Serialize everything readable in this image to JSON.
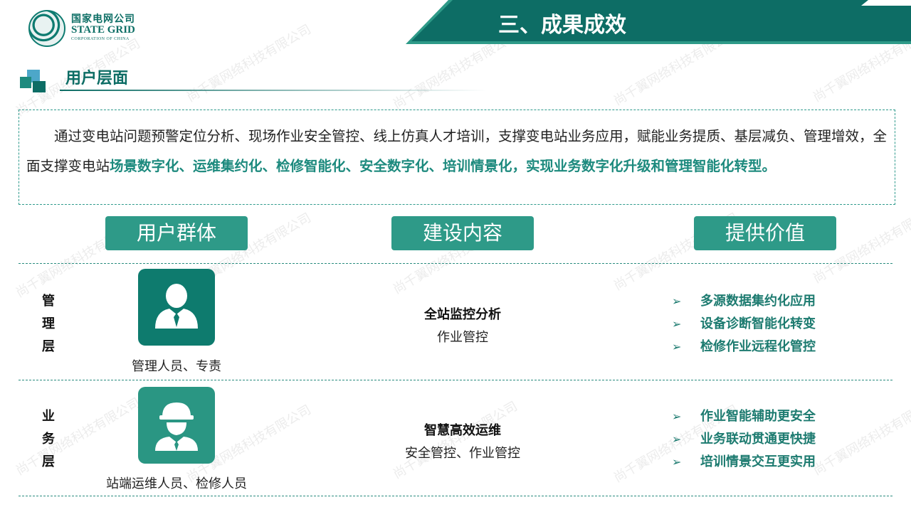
{
  "header": {
    "logo_cn": "国家电网公司",
    "logo_en": "STATE GRID",
    "logo_en_sub": "CORPORATION OF CHINA",
    "title": "三、成果成效"
  },
  "section": {
    "title": "用户层面"
  },
  "intro": {
    "plain": "通过变电站问题预警定位分析、现场作业安全管控、线上仿真人才培训，支撑变电站业务应用，赋能业务提质、基层减负、管理增效，全面支撑变电站",
    "highlight": "场景数字化、运维集约化、检修智能化、安全数字化、培训情景化，实现业务数字化升级和管理智能化转型。"
  },
  "columns": {
    "group": "用户群体",
    "content": "建设内容",
    "value": "提供价值"
  },
  "rows": [
    {
      "layer_chars": [
        "管",
        "理",
        "层"
      ],
      "icon": "manager-person-icon",
      "caption": "管理人员、专责",
      "content_title": "全站监控分析",
      "content_sub": "作业管控",
      "values": [
        "多源数据集约化应用",
        "设备诊断智能化转变",
        "检修作业远程化管控"
      ]
    },
    {
      "layer_chars": [
        "业",
        "务",
        "层"
      ],
      "icon": "worker-helmet-icon",
      "caption": "站端运维人员、检修人员",
      "content_title": "智慧高效运维",
      "content_sub": "安全管控、作业管控",
      "values": [
        "作业智能辅助更安全",
        "业务联动贯通更快捷",
        "培训情景交互更实用"
      ]
    }
  ],
  "bullet_glyph": "➢",
  "colors": {
    "primary": "#0d6d65",
    "accent": "#2e9a88",
    "highlight": "#1d8a7e"
  },
  "watermark": "尚千翼网络科技有限公司"
}
